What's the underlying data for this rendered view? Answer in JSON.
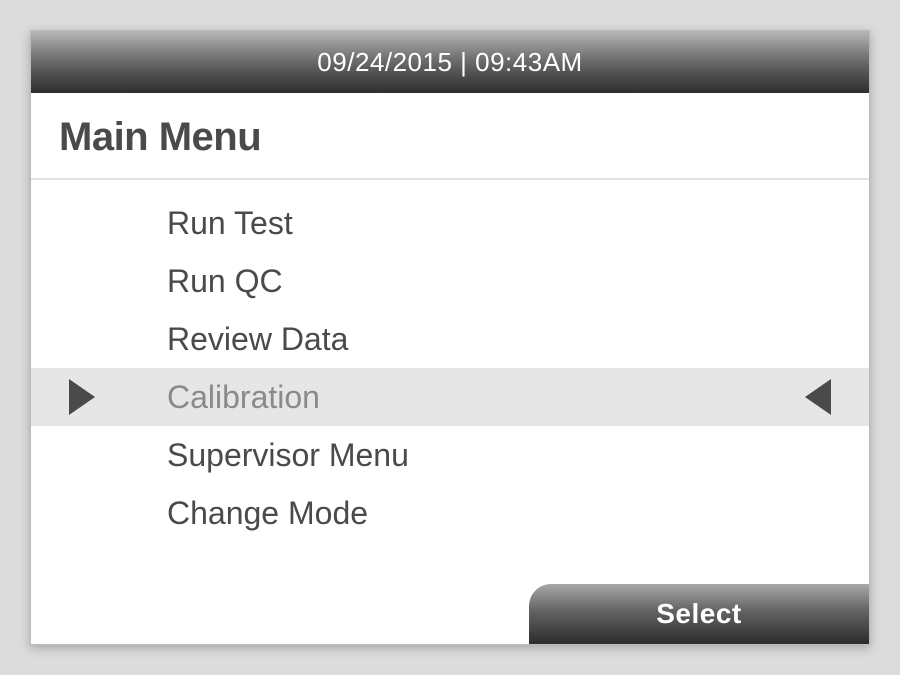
{
  "header": {
    "datetime": "09/24/2015 | 09:43AM"
  },
  "title": "Main Menu",
  "menu": {
    "items": [
      {
        "label": "Run Test"
      },
      {
        "label": "Run QC"
      },
      {
        "label": "Review Data"
      },
      {
        "label": "Calibration"
      },
      {
        "label": "Supervisor Menu"
      },
      {
        "label": "Change Mode"
      }
    ],
    "selected_index": 3
  },
  "footer": {
    "select_label": "Select"
  }
}
